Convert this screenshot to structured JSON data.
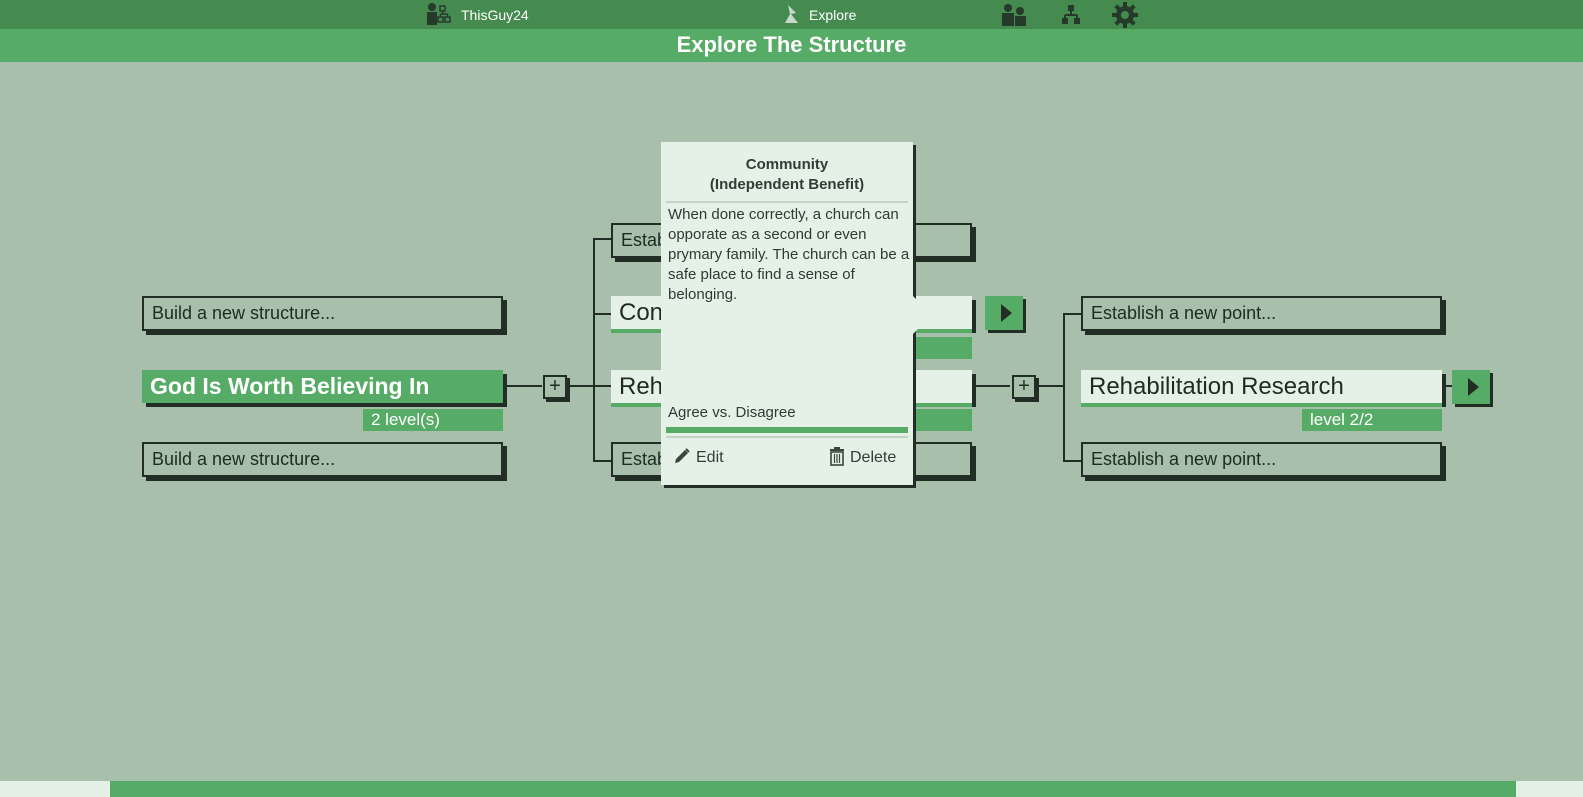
{
  "nav": {
    "user_name": "ThisGuy24",
    "section_label": "Explore",
    "icons": [
      "user-structure-icon",
      "explore-flag-icon",
      "people-icon",
      "hierarchy-icon",
      "gear-icon"
    ]
  },
  "page_title": "Explore The Structure",
  "left_column": {
    "top_placeholder": "Build a new structure...",
    "selected_title": "God Is Worth Believing In",
    "selected_badge": "2 level(s)",
    "bottom_placeholder": "Build a new structure..."
  },
  "middle_column": {
    "top_placeholder_partial": "Estab",
    "item_community_partial": "Con",
    "item_rehab_partial": "Reh",
    "bottom_placeholder_partial": "Estab"
  },
  "right_column": {
    "top_placeholder": "Establish a new point...",
    "selected_title": "Rehabilitation Research",
    "selected_badge": "level 2/2",
    "bottom_placeholder": "Establish a new point..."
  },
  "popup": {
    "title_line1": "Community",
    "title_line2": "(Independent Benefit)",
    "description": "When done correctly, a church can opporate as a second or even prymary family. The church can be a safe place to find a sense of belonging.",
    "agreement_label": "Agree vs. Disagree",
    "agreement_fraction": 1.0,
    "edit_label": "Edit",
    "delete_label": "Delete"
  },
  "colors": {
    "topbar": "#458a4f",
    "accent_green": "#56ab66",
    "background": "#a8bfab",
    "panel_light": "#e5f1e7",
    "outline": "#222e25"
  }
}
